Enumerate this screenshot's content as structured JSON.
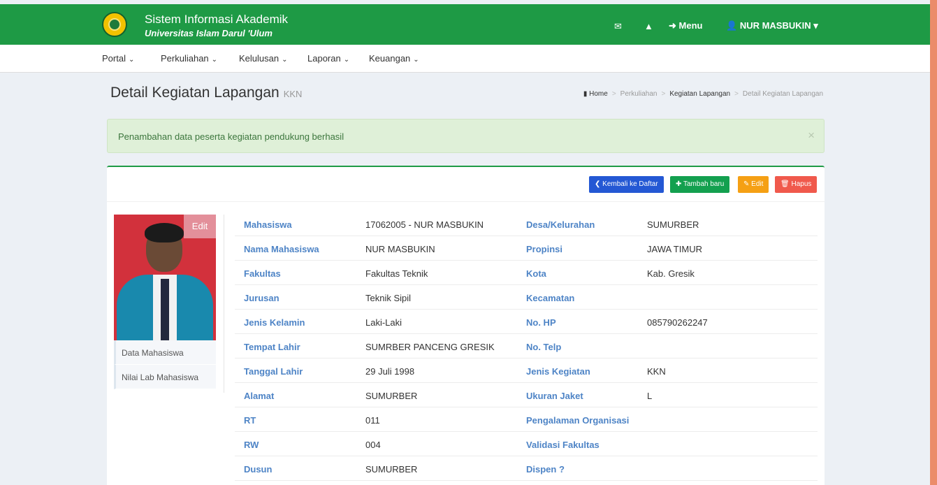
{
  "header": {
    "title": "Sistem Informasi Akademik",
    "subtitle": "Universitas Islam Darul 'Ulum",
    "menu_label": "Menu",
    "user_name": "NUR MASBUKIN"
  },
  "nav": [
    "Portal",
    "Perkuliahan",
    "Kelulusan",
    "Laporan",
    "Keuangan"
  ],
  "page": {
    "title": "Detail Kegiatan Lapangan",
    "subtitle": "KKN"
  },
  "breadcrumb": [
    "Home",
    "Perkuliahan",
    "Kegiatan Lapangan",
    "Detail Kegiatan Lapangan"
  ],
  "alert": {
    "message": "Penambahan data peserta kegiatan pendukung berhasil",
    "close": "×"
  },
  "buttons": {
    "back": "Kembali ke Daftar",
    "add": "Tambah baru",
    "edit": "Edit",
    "delete": "Hapus"
  },
  "photo": {
    "edit_label": "Edit"
  },
  "side_menu": [
    "Data Mahasiswa",
    "Nilai Lab Mahasiswa"
  ],
  "details": [
    {
      "label1": "Mahasiswa",
      "value1": "17062005 - NUR MASBUKIN",
      "label2": "Desa/Kelurahan",
      "value2": "SUMURBER"
    },
    {
      "label1": "Nama Mahasiswa",
      "value1": "NUR MASBUKIN",
      "label2": "Propinsi",
      "value2": "JAWA TIMUR"
    },
    {
      "label1": "Fakultas",
      "value1": "Fakultas Teknik",
      "label2": "Kota",
      "value2": "Kab. Gresik"
    },
    {
      "label1": "Jurusan",
      "value1": "Teknik Sipil",
      "label2": "Kecamatan",
      "value2": ""
    },
    {
      "label1": "Jenis Kelamin",
      "value1": "Laki-Laki",
      "label2": "No. HP",
      "value2": "085790262247"
    },
    {
      "label1": "Tempat Lahir",
      "value1": "SUMRBER PANCENG GRESIK",
      "label2": "No. Telp",
      "value2": ""
    },
    {
      "label1": "Tanggal Lahir",
      "value1": "29 Juli 1998",
      "label2": "Jenis Kegiatan",
      "value2": "KKN"
    },
    {
      "label1": "Alamat",
      "value1": "SUMURBER",
      "label2": "Ukuran Jaket",
      "value2": "L"
    },
    {
      "label1": "RT",
      "value1": "011",
      "label2": "Pengalaman Organisasi",
      "value2": ""
    },
    {
      "label1": "RW",
      "value1": "004",
      "label2": "Validasi Fakultas",
      "value2": ""
    },
    {
      "label1": "Dusun",
      "value1": "SUMURBER",
      "label2": "Dispen ?",
      "value2": ""
    }
  ],
  "colors": {
    "brand_green": "#1e9a45",
    "label_blue": "#4e84c6",
    "alert_bg": "#dff0d8"
  }
}
